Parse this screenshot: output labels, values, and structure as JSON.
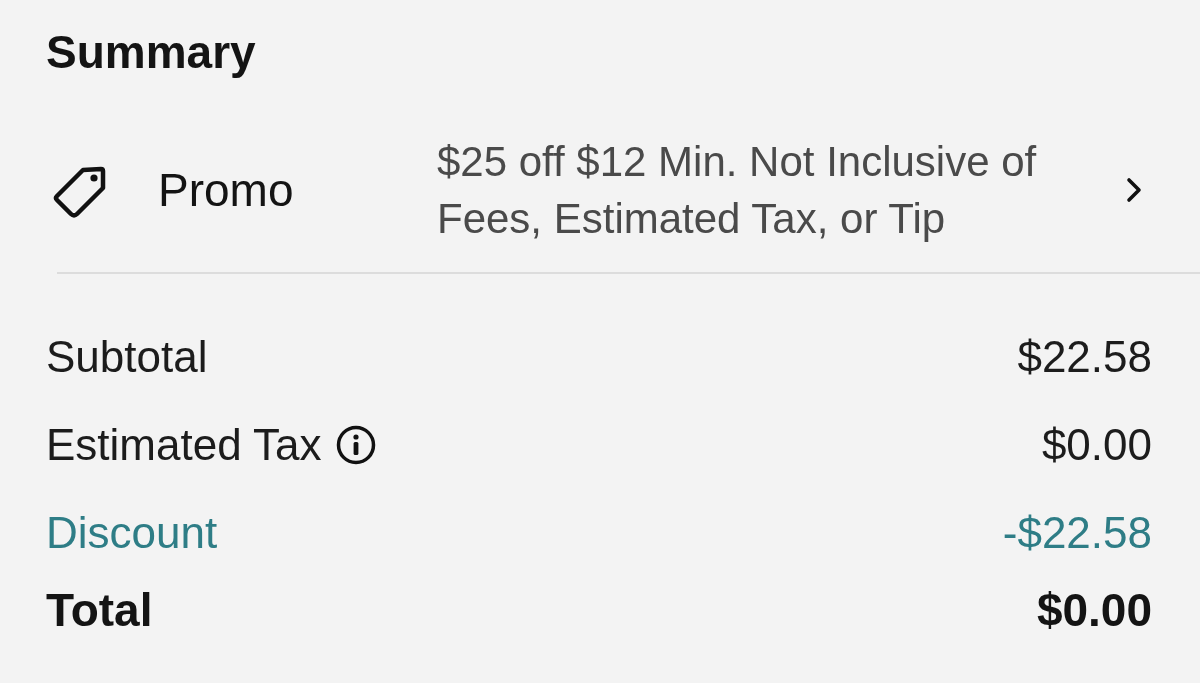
{
  "title": "Summary",
  "promo": {
    "label": "Promo",
    "description": "$25 off $12 Min. Not Inclusive of Fees, Estimated Tax, or Tip"
  },
  "lines": [
    {
      "label": "Subtotal",
      "amount": "$22.58",
      "kind": "normal"
    },
    {
      "label": "Estimated Tax",
      "amount": "$0.00",
      "kind": "normal",
      "info": true
    },
    {
      "label": "Discount",
      "amount": "-$22.58",
      "kind": "discount"
    },
    {
      "label": "Total",
      "amount": "$0.00",
      "kind": "total"
    }
  ]
}
